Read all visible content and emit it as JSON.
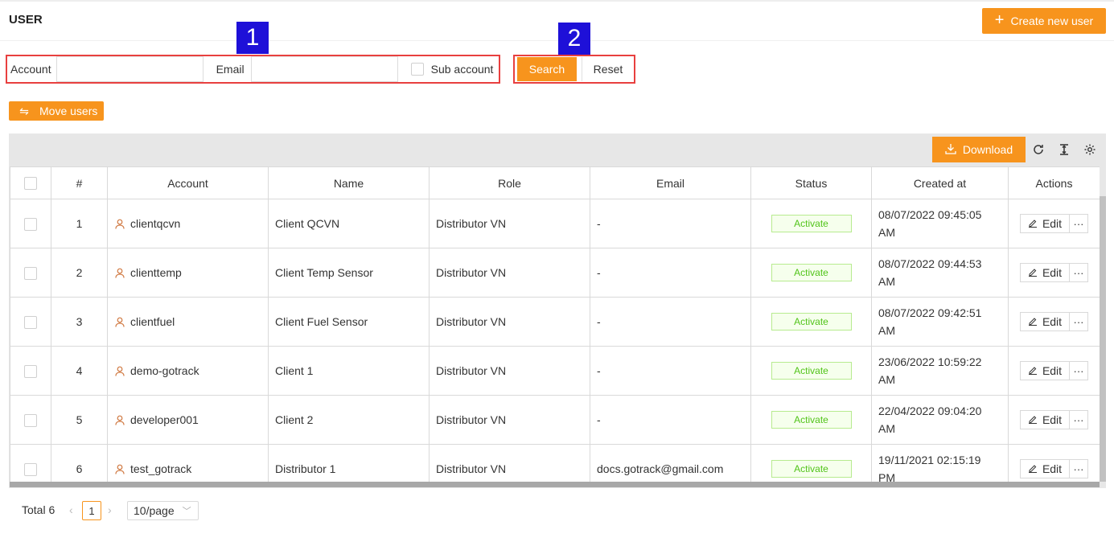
{
  "page": {
    "title": "USER",
    "create_label": "Create new user"
  },
  "filter": {
    "account_label": "Account",
    "account_value": "",
    "email_label": "Email",
    "email_value": "",
    "sub_account_label": "Sub account"
  },
  "actions": {
    "search_label": "Search",
    "reset_label": "Reset"
  },
  "annotations": {
    "badge1": "1",
    "badge2": "2"
  },
  "toolbar": {
    "move_label": "Move users",
    "download_label": "Download"
  },
  "table": {
    "headers": [
      "#",
      "Account",
      "Name",
      "Role",
      "Email",
      "Status",
      "Created at",
      "Actions"
    ],
    "rows": [
      {
        "num": "1",
        "account": "clientqcvn",
        "name": "Client QCVN",
        "role": "Distributor VN",
        "email": "-",
        "status": "Activate",
        "created_line1": "08/07/2022 09:45:05",
        "created_line2": "AM",
        "edit": "Edit"
      },
      {
        "num": "2",
        "account": "clienttemp",
        "name": "Client Temp Sensor",
        "role": "Distributor VN",
        "email": "-",
        "status": "Activate",
        "created_line1": "08/07/2022 09:44:53",
        "created_line2": "AM",
        "edit": "Edit"
      },
      {
        "num": "3",
        "account": "clientfuel",
        "name": "Client Fuel Sensor",
        "role": "Distributor VN",
        "email": "-",
        "status": "Activate",
        "created_line1": "08/07/2022 09:42:51",
        "created_line2": "AM",
        "edit": "Edit"
      },
      {
        "num": "4",
        "account": "demo-gotrack",
        "name": "Client 1",
        "role": "Distributor VN",
        "email": "-",
        "status": "Activate",
        "created_line1": "23/06/2022 10:59:22",
        "created_line2": "AM",
        "edit": "Edit"
      },
      {
        "num": "5",
        "account": "developer001",
        "name": "Client 2",
        "role": "Distributor VN",
        "email": "-",
        "status": "Activate",
        "created_line1": "22/04/2022 09:04:20",
        "created_line2": "AM",
        "edit": "Edit"
      },
      {
        "num": "6",
        "account": "test_gotrack",
        "name": "Distributor 1",
        "role": "Distributor VN",
        "email": "docs.gotrack@gmail.com",
        "status": "Activate",
        "created_line1": "19/11/2021 02:15:19",
        "created_line2": "PM",
        "edit": "Edit"
      }
    ]
  },
  "pagination": {
    "total": "Total 6",
    "current_page": "1",
    "per_page": "10/page"
  },
  "colors": {
    "accent": "#f7941d",
    "highlight_border": "#e8403f",
    "badge": "#1e10d8",
    "status_green": "#52c41a"
  },
  "icons": [
    "plus-icon",
    "swap-icon",
    "download-icon",
    "refresh-icon",
    "column-height-icon",
    "settings-icon",
    "user-icon",
    "edit-icon",
    "more-icon",
    "chevron-left-icon",
    "chevron-right-icon",
    "chevron-down-icon"
  ]
}
